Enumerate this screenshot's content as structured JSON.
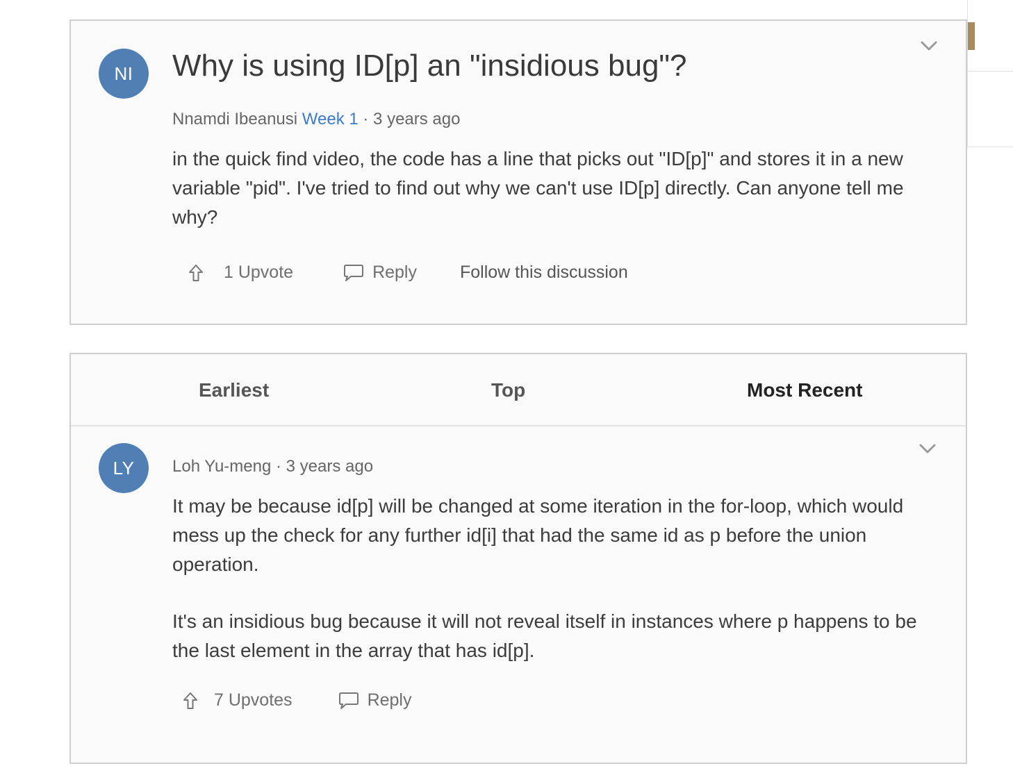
{
  "question": {
    "avatar_initials": "NI",
    "title": "Why is using ID[p] an \"insidious bug\"?",
    "author": "Nnamdi Ibeanusi",
    "week": "Week 1",
    "time": "· 3 years ago",
    "body": "in the quick find video, the code has a line that picks out \"ID[p]\" and stores it in a new variable \"pid\". I've tried to find out why we can't use ID[p] directly. Can anyone tell me why?",
    "upvote_label": "1 Upvote",
    "reply_label": "Reply",
    "follow_label": "Follow this discussion"
  },
  "sort_tabs": {
    "earliest": "Earliest",
    "top": "Top",
    "most_recent": "Most Recent",
    "active": "most_recent"
  },
  "answer": {
    "avatar_initials": "LY",
    "author_time": "Loh Yu-meng · 3 years ago",
    "paragraph1": "It may be because id[p] will be changed at some iteration in the for-loop, which would mess up the check for any further id[i] that had the same id as p before the union operation.",
    "paragraph2": "It's an insidious bug because it will not reveal itself in instances where p happens to be the last element in the array that has id[p].",
    "upvote_label": "7 Upvotes",
    "reply_label": "Reply"
  },
  "colors": {
    "avatar": "#4f7fb5",
    "link": "#3d7cc9",
    "side_accent": "#a88a5e"
  },
  "icons": [
    "chevron-down-icon",
    "upvote-arrow-icon",
    "speech-bubble-icon"
  ]
}
